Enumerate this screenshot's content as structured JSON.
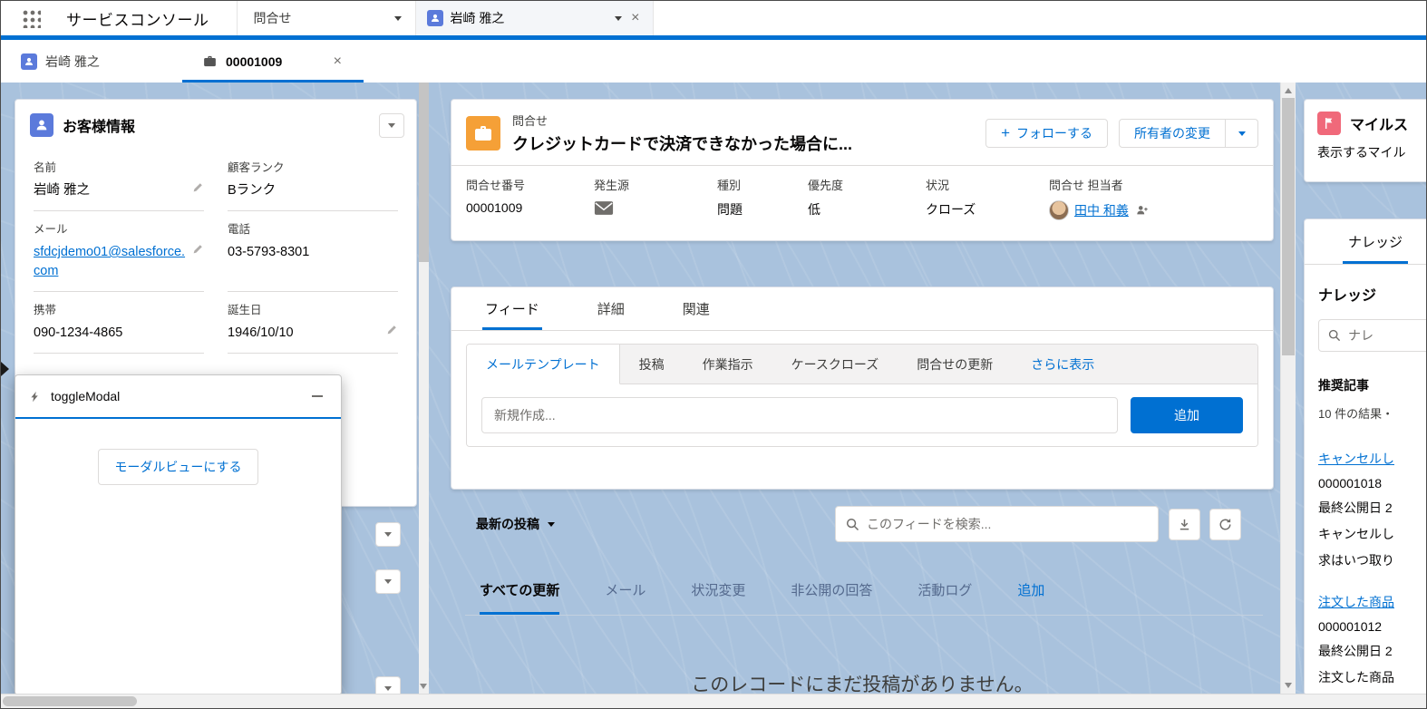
{
  "colors": {
    "brand_blue": "#0070d2",
    "link_blue": "#0070d2",
    "case_icon_bg": "#f5a037",
    "contact_icon_bg": "#5b7adb",
    "milestone_icon_bg": "#f0697a",
    "workspace_bg": "#a9c2dd"
  },
  "global_nav": {
    "app_name": "サービスコンソール",
    "nav_tab": "問合せ",
    "workspace_tab": "岩崎 雅之"
  },
  "subtab_bar": {
    "tabs": [
      {
        "label": "岩崎 雅之"
      },
      {
        "label": "00001009"
      }
    ]
  },
  "customer_card": {
    "title": "お客様情報",
    "fields": [
      {
        "label": "名前",
        "value": "岩崎 雅之"
      },
      {
        "label": "顧客ランク",
        "value": "Bランク"
      },
      {
        "label": "メール",
        "value": "sfdcjdemo01@salesforce.com"
      },
      {
        "label": "電話",
        "value": "03-5793-8301"
      },
      {
        "label": "携帯",
        "value": "090-1234-4865"
      },
      {
        "label": "誕生日",
        "value": "1946/10/10"
      }
    ]
  },
  "toggle_modal": {
    "title": "toggleModal",
    "button_label": "モーダルビューにする"
  },
  "case_panel": {
    "entity_label": "問合せ",
    "title": "クレジットカードで決済できなかった場合に...",
    "follow_button": "フォローする",
    "change_owner_button": "所有者の変更",
    "highlight_fields": [
      {
        "label": "問合せ番号",
        "value": "00001009"
      },
      {
        "label": "発生源",
        "value": ""
      },
      {
        "label": "種別",
        "value": "問題"
      },
      {
        "label": "優先度",
        "value": "低"
      },
      {
        "label": "状況",
        "value": "クローズ"
      },
      {
        "label": "問合せ 担当者",
        "value": "田中 和義"
      }
    ],
    "record_tabs": [
      {
        "label": "フィード"
      },
      {
        "label": "詳細"
      },
      {
        "label": "関連"
      }
    ],
    "publisher": {
      "tabs": [
        {
          "label": "メールテンプレート"
        },
        {
          "label": "投稿"
        },
        {
          "label": "作業指示"
        },
        {
          "label": "ケースクローズ"
        },
        {
          "label": "問合せの更新"
        }
      ],
      "more_label": "さらに表示",
      "input_placeholder": "新規作成...",
      "add_button": "追加"
    },
    "feed": {
      "sort_label": "最新の投稿",
      "search_placeholder": "このフィードを検索...",
      "filters": [
        {
          "label": "すべての更新"
        },
        {
          "label": "メール"
        },
        {
          "label": "状況変更"
        },
        {
          "label": "非公開の回答"
        },
        {
          "label": "活動ログ"
        }
      ],
      "add_filter_label": "追加",
      "empty_message": "このレコードにまだ投稿がありません。"
    }
  },
  "milestone_card": {
    "title": "マイルス",
    "body": "表示するマイル"
  },
  "knowledge_panel": {
    "tab_label": "ナレッジ",
    "heading": "ナレッジ",
    "search_placeholder": "ナレ",
    "recommended_heading": "推奨記事",
    "results_count": "10 件の結果・",
    "articles": [
      {
        "title": "キャンセルし",
        "number": "000001018",
        "published": "最終公開日 2",
        "line1": "キャンセルし",
        "line2": "求はいつ取り"
      },
      {
        "title": "注文した商品",
        "number": "000001012",
        "published": "最終公開日 2",
        "line1": "注文した商品",
        "line2": ""
      }
    ]
  }
}
